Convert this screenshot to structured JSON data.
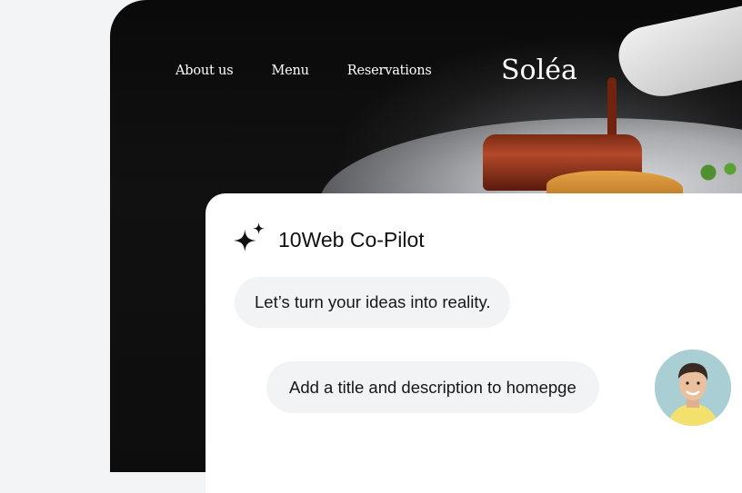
{
  "site": {
    "nav": [
      {
        "label": "About us"
      },
      {
        "label": "Menu"
      },
      {
        "label": "Reservations"
      }
    ],
    "brand": "Soléa"
  },
  "copilot": {
    "title": "10Web Co-Pilot",
    "bot_message": "Let’s turn your ideas into reality.",
    "user_message": "Add a title and description to homepge"
  }
}
